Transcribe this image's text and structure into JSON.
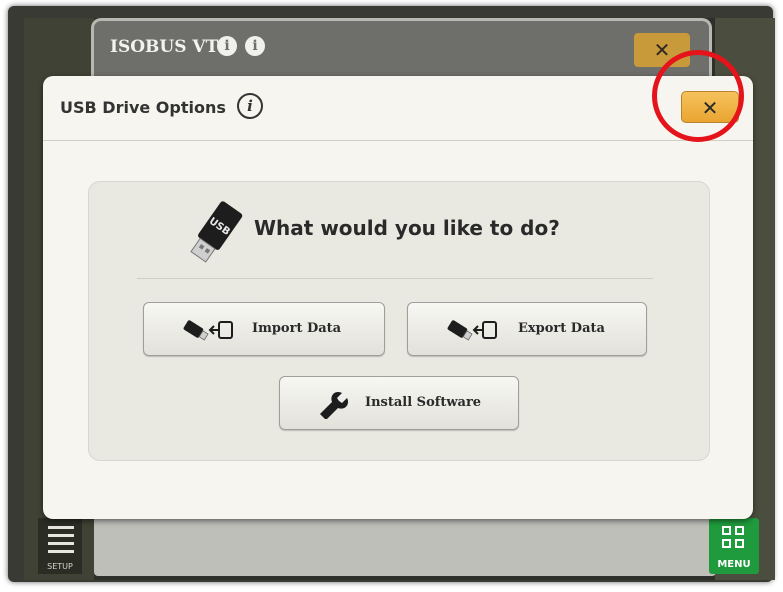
{
  "background_window": {
    "title": "ISOBUS VT",
    "info_glyph": "i",
    "close_glyph": "✕"
  },
  "dialog": {
    "title": "USB Drive Options",
    "info_glyph": "i",
    "close_glyph": "✕",
    "prompt": "What would you like to do?",
    "buttons": {
      "import": "Import Data",
      "export": "Export Data",
      "install": "Install Software"
    }
  },
  "sidebar": {
    "setup_label": "SETUP",
    "menu_label": "MENU"
  },
  "icons": {
    "usb": "usb-drive-icon",
    "import": "usb-import-icon",
    "export": "usb-export-icon",
    "install": "wrench-icon",
    "info": "info-icon",
    "close": "close-icon"
  },
  "colors": {
    "close_button": "#e9a532",
    "highlight_ring": "#e4141a",
    "menu_button": "#1f9a3c",
    "dialog_bg": "#f6f5ef"
  }
}
